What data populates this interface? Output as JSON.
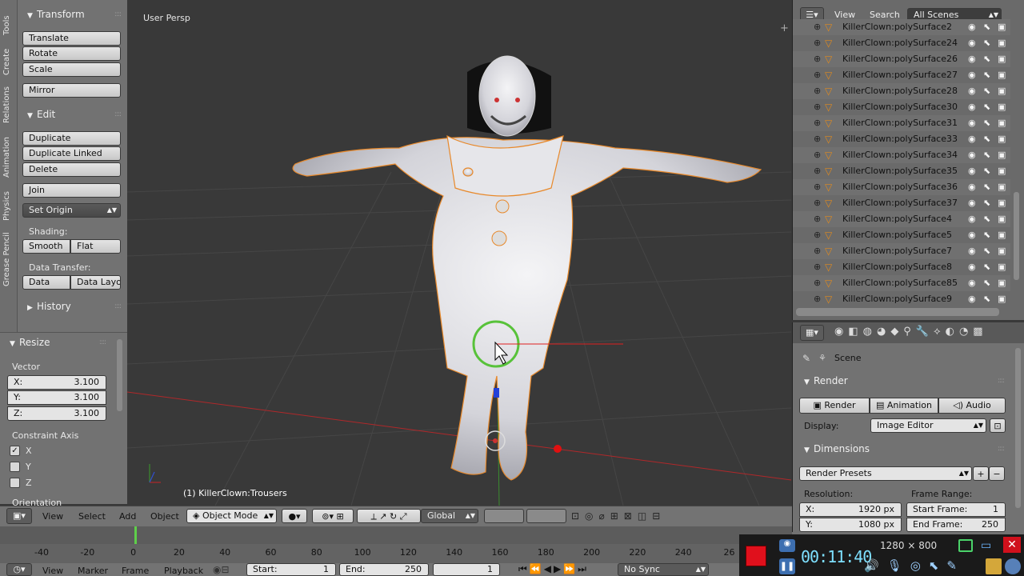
{
  "viewport": {
    "view_name": "User Persp",
    "object_info": "(1) KillerClown:Trousers"
  },
  "tool_tabs": [
    "Tools",
    "Create",
    "Relations",
    "Animation",
    "Physics",
    "Grease Pencil"
  ],
  "tool_shelf": {
    "transform_title": "Transform",
    "translate": "Translate",
    "rotate": "Rotate",
    "scale": "Scale",
    "mirror": "Mirror",
    "edit_title": "Edit",
    "duplicate": "Duplicate",
    "duplicate_linked": "Duplicate Linked",
    "delete": "Delete",
    "join": "Join",
    "set_origin": "Set Origin",
    "shading_label": "Shading:",
    "smooth": "Smooth",
    "flat": "Flat",
    "data_transfer_label": "Data Transfer:",
    "data": "Data",
    "data_layout": "Data Layo",
    "history_title": "History"
  },
  "operator_panel": {
    "title": "Resize",
    "vector_label": "Vector",
    "x_label": "X:",
    "x_value": "3.100",
    "y_label": "Y:",
    "y_value": "3.100",
    "z_label": "Z:",
    "z_value": "3.100",
    "constraint_label": "Constraint Axis",
    "axis_x": "X",
    "axis_y": "Y",
    "axis_z": "Z",
    "axis_x_checked": true,
    "orientation_label": "Orientation"
  },
  "outliner": {
    "view": "View",
    "search": "Search",
    "scenes_selector": "All Scenes",
    "items": [
      "KillerClown:polySurface2",
      "KillerClown:polySurface24",
      "KillerClown:polySurface26",
      "KillerClown:polySurface27",
      "KillerClown:polySurface28",
      "KillerClown:polySurface30",
      "KillerClown:polySurface31",
      "KillerClown:polySurface33",
      "KillerClown:polySurface34",
      "KillerClown:polySurface35",
      "KillerClown:polySurface36",
      "KillerClown:polySurface37",
      "KillerClown:polySurface4",
      "KillerClown:polySurface5",
      "KillerClown:polySurface7",
      "KillerClown:polySurface8",
      "KillerClown:polySurface85",
      "KillerClown:polySurface9"
    ]
  },
  "properties": {
    "scene": "Scene",
    "render_title": "Render",
    "render_btn": "Render",
    "animation_btn": "Animation",
    "audio_btn": "Audio",
    "display_label": "Display:",
    "display_value": "Image Editor",
    "dimensions_title": "Dimensions",
    "render_presets": "Render Presets",
    "resolution_label": "Resolution:",
    "frame_range_label": "Frame Range:",
    "res_x_label": "X:",
    "res_x": "1920 px",
    "res_y_label": "Y:",
    "res_y": "1080 px",
    "start_frame_label": "Start Frame:",
    "start_frame": "1",
    "end_frame_label": "End Frame:",
    "end_frame": "250"
  },
  "view_header": {
    "view": "View",
    "select": "Select",
    "add": "Add",
    "object": "Object",
    "mode": "Object Mode",
    "orientation": "Global"
  },
  "timeline": {
    "ticks": [
      "-40",
      "-20",
      "0",
      "20",
      "40",
      "60",
      "80",
      "100",
      "120",
      "140",
      "160",
      "180",
      "200",
      "220",
      "240",
      "26"
    ],
    "view": "View",
    "marker": "Marker",
    "frame": "Frame",
    "playback": "Playback",
    "start_label": "Start:",
    "start_value": "1",
    "end_label": "End:",
    "end_value": "250",
    "current_frame": "1",
    "sync": "No Sync"
  },
  "recorder": {
    "time": "00:11:40",
    "resolution": "1280 × 800"
  },
  "colors": {
    "selection_outline": "#e8892b",
    "x_axis": "#b0282a",
    "y_axis": "#3b8c2f",
    "grid": "#454545",
    "record_red": "#e0101c"
  }
}
